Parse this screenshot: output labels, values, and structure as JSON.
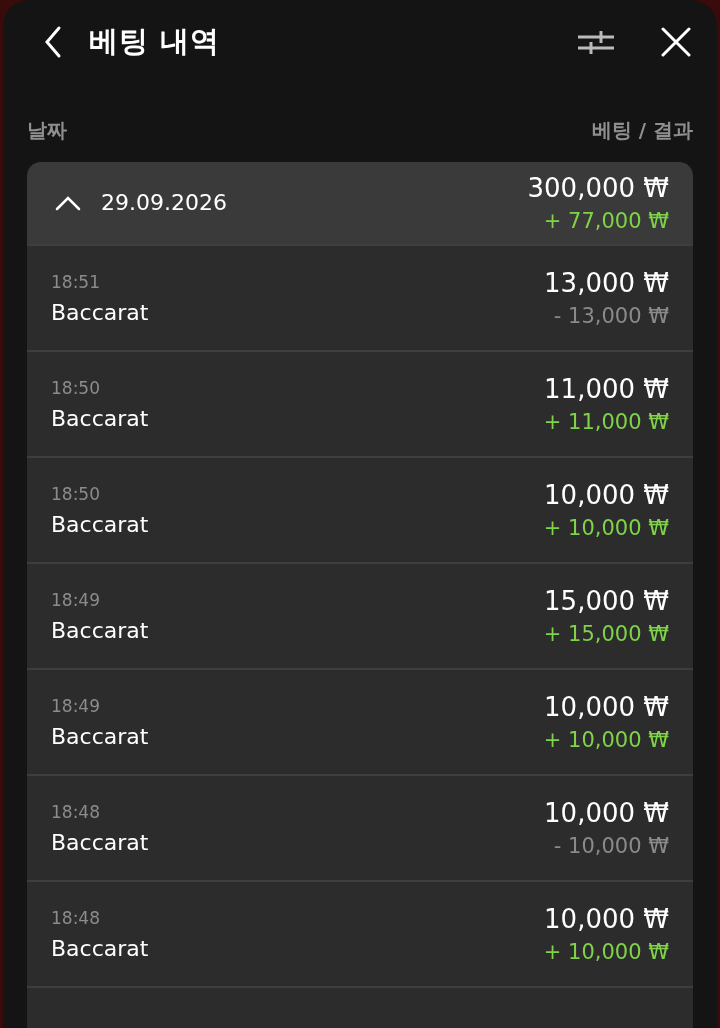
{
  "header": {
    "title": "베팅 내역"
  },
  "columns": {
    "date": "날짜",
    "bet_result": "베팅 / 결과"
  },
  "group": {
    "date": "29.09.2026",
    "expanded": true,
    "total": {
      "bet": "300,000 ₩",
      "result": "+ 77,000 ₩",
      "color": "#7ed348"
    },
    "rows": [
      {
        "time": "18:51",
        "game": "Baccarat",
        "bet": "13,000 ₩",
        "result": "- 13,000 ₩",
        "color": "#8a8a8a"
      },
      {
        "time": "18:50",
        "game": "Baccarat",
        "bet": "11,000 ₩",
        "result": "+ 11,000 ₩",
        "color": "#7ed348"
      },
      {
        "time": "18:50",
        "game": "Baccarat",
        "bet": "10,000 ₩",
        "result": "+ 10,000 ₩",
        "color": "#7ed348"
      },
      {
        "time": "18:49",
        "game": "Baccarat",
        "bet": "15,000 ₩",
        "result": "+ 15,000 ₩",
        "color": "#7ed348"
      },
      {
        "time": "18:49",
        "game": "Baccarat",
        "bet": "10,000 ₩",
        "result": "+ 10,000 ₩",
        "color": "#7ed348"
      },
      {
        "time": "18:48",
        "game": "Baccarat",
        "bet": "10,000 ₩",
        "result": "- 10,000 ₩",
        "color": "#8a8a8a"
      },
      {
        "time": "18:48",
        "game": "Baccarat",
        "bet": "10,000 ₩",
        "result": "+ 10,000 ₩",
        "color": "#7ed348"
      }
    ]
  }
}
